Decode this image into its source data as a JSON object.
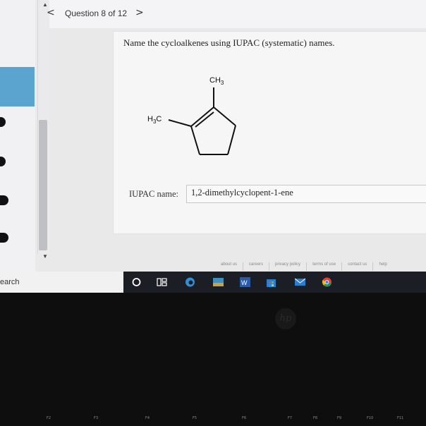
{
  "nav": {
    "prev_symbol": "<",
    "next_symbol": ">",
    "title": "Question 8 of 12"
  },
  "question": {
    "prompt": "Name the cycloalkenes using IUPAC (systematic) names.",
    "structure": {
      "top_label": "CH3",
      "left_label": "H3C"
    },
    "answer_label": "IUPAC name:",
    "answer_value": "1,2-dimethylcyclopent-1-ene"
  },
  "footer_links": [
    "about us",
    "careers",
    "privacy policy",
    "terms of use",
    "contact us",
    "help"
  ],
  "taskbar": {
    "search_label": "earch"
  },
  "colors": {
    "accent_blue": "#5aa4cf",
    "taskbar": "#1c1e25"
  },
  "keyboard": {
    "fn_labels": [
      "F2",
      "F3",
      "F4",
      "F5",
      "F6",
      "F7",
      "F8",
      "F9",
      "F10",
      "F11"
    ]
  }
}
